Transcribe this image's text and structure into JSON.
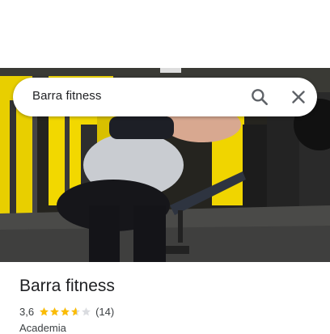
{
  "search": {
    "query": "Barra fitness"
  },
  "place": {
    "name": "Barra fitness",
    "rating_value": "3,6",
    "rating": 3.6,
    "rating_max": 5,
    "review_count": "(14)",
    "category": "Academia"
  },
  "icons": {
    "search": "search-icon",
    "close": "close-icon",
    "star": "star-icon"
  },
  "colors": {
    "star_filled": "#fbbc04",
    "star_empty": "#dadce0",
    "text_primary": "#202124",
    "icon_gray": "#5f6368",
    "gym_yellow": "#f2d800"
  }
}
